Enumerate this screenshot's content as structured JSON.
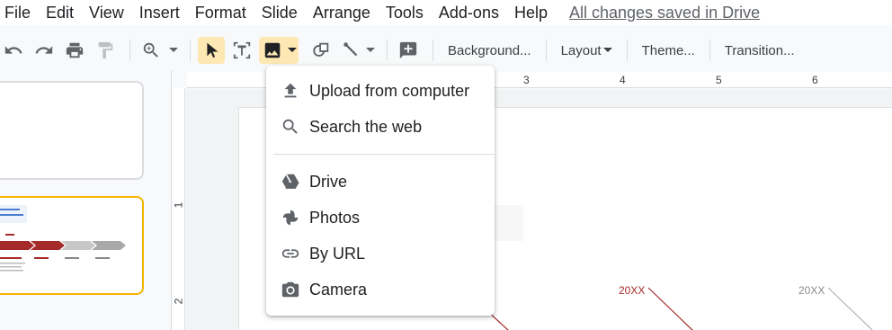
{
  "menubar": {
    "items": [
      "File",
      "Edit",
      "View",
      "Insert",
      "Format",
      "Slide",
      "Arrange",
      "Tools",
      "Add-ons",
      "Help"
    ],
    "saved_status": "All changes saved in Drive"
  },
  "toolbar": {
    "background_label": "Background...",
    "layout_label": "Layout",
    "theme_label": "Theme...",
    "transition_label": "Transition..."
  },
  "ruler": {
    "top_numbers": [
      "3",
      "4",
      "5",
      "6"
    ],
    "left_numbers": [
      "1",
      "2"
    ]
  },
  "slide": {
    "year_1": "20XX",
    "year_2": "20XX",
    "accent_color": "#a52a2a"
  },
  "image_menu": {
    "upload": "Upload from computer",
    "search": "Search the web",
    "drive": "Drive",
    "photos": "Photos",
    "by_url": "By URL",
    "camera": "Camera"
  },
  "icons": [
    "undo-icon",
    "redo-icon",
    "print-icon",
    "paint-format-icon",
    "zoom-icon",
    "select-icon",
    "textbox-icon",
    "image-icon",
    "shape-icon",
    "line-icon",
    "comment-add-icon",
    "upload-icon",
    "search-icon",
    "drive-icon",
    "photos-icon",
    "link-icon",
    "camera-icon"
  ]
}
